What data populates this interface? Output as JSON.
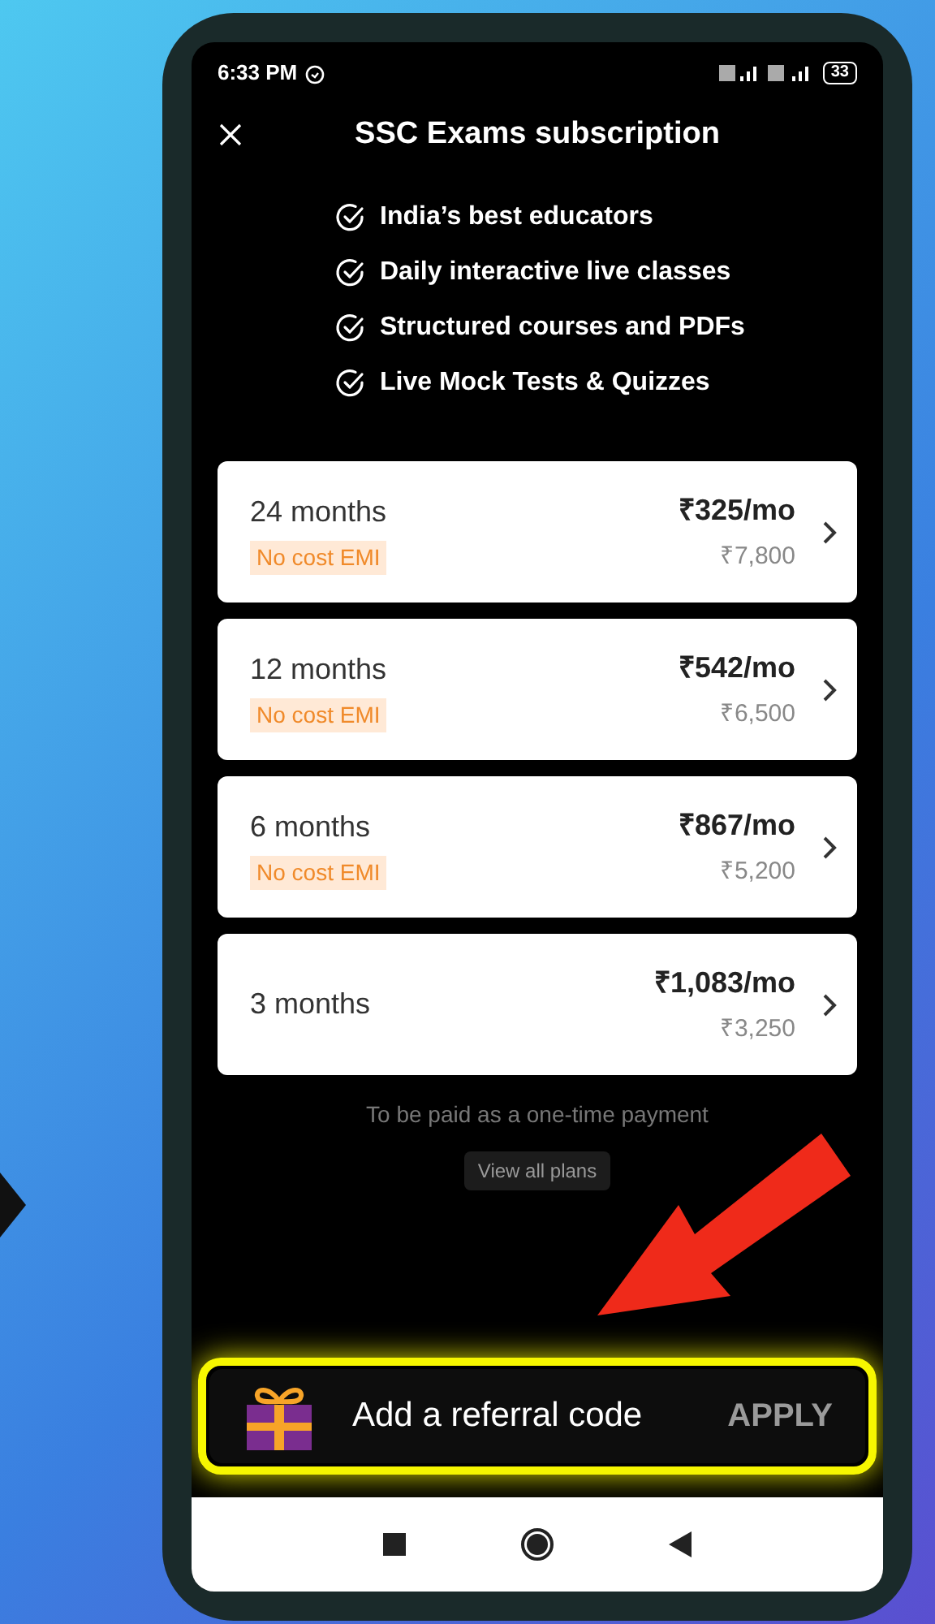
{
  "status_bar": {
    "time": "6:33 PM",
    "battery": "33"
  },
  "header": {
    "title": "SSC Exams subscription"
  },
  "features": [
    "India’s best educators",
    "Daily interactive live classes",
    "Structured courses and PDFs",
    "Live Mock Tests & Quizzes"
  ],
  "plans": [
    {
      "duration": "24 months",
      "badge": "No cost EMI",
      "price": "₹325/mo",
      "total": "₹7,800"
    },
    {
      "duration": "12 months",
      "badge": "No cost EMI",
      "price": "₹542/mo",
      "total": "₹6,500"
    },
    {
      "duration": "6 months",
      "badge": "No cost EMI",
      "price": "₹867/mo",
      "total": "₹5,200"
    },
    {
      "duration": "3 months",
      "price": "₹1,083/mo",
      "total": "₹3,250"
    }
  ],
  "note": "To be paid as a one-time payment",
  "view_all_button": "View all plans",
  "referral": {
    "label": "Add a referral code",
    "action": "APPLY"
  }
}
